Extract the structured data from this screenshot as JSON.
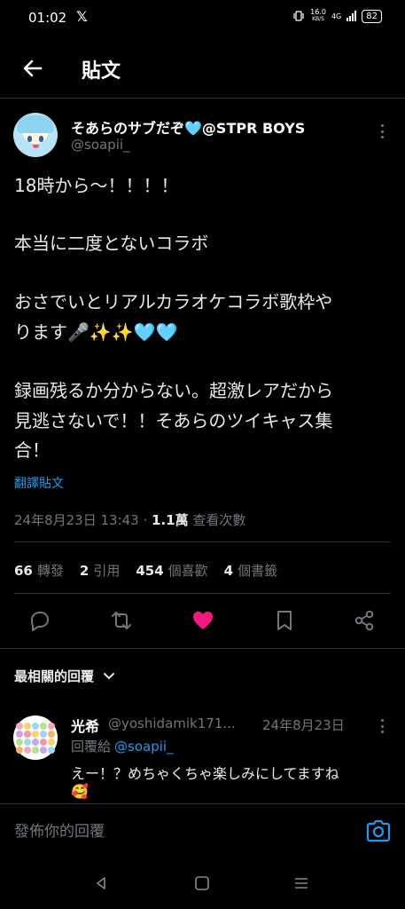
{
  "status_bar": {
    "time": "01:02",
    "notification": "𝕏",
    "net_speed": "16.0",
    "net_unit": "KB/S",
    "network": "4G",
    "battery": "82"
  },
  "header": {
    "title": "貼文"
  },
  "tweet": {
    "author": "そあらのサブだぞ🩵@STPR BOYS",
    "handle": "@soapii_",
    "lines": [
      "18時から〜！！！！",
      "本当に二度とないコラボ",
      "おさでいとリアルカラオケコラボ歌枠や",
      "ります🎤✨✨🩵🩵",
      "録画残るか分からない。超激レアだから",
      "見逃さないで！！そあらのツイキャス集",
      "合！"
    ],
    "translate": "翻譯貼文",
    "timestamp": "24年8月23日 13:43",
    "views_count": "1.1萬",
    "views_label": "查看次數"
  },
  "stats": {
    "retweets": "66",
    "retweets_label": "轉發",
    "quotes": "2",
    "quotes_label": "引用",
    "likes": "454",
    "likes_label": "個喜歡",
    "bookmarks": "4",
    "bookmarks_label": "個書籤"
  },
  "colors": {
    "accent": "#1d9bf0",
    "like": "#f91880",
    "muted": "#71767b",
    "divider": "#2f3336"
  },
  "sort": {
    "label": "最相關的回覆"
  },
  "reply": {
    "name": "光希",
    "handle": "@yoshidamik171...",
    "date": "24年8月23日",
    "reply_to_label": "回覆給",
    "reply_to_handle": "@soapii_",
    "text": "えー！？めちゃくちゃ楽しみにしてますね",
    "emoji": "🥰"
  },
  "composer": {
    "placeholder": "發佈你的回覆"
  }
}
